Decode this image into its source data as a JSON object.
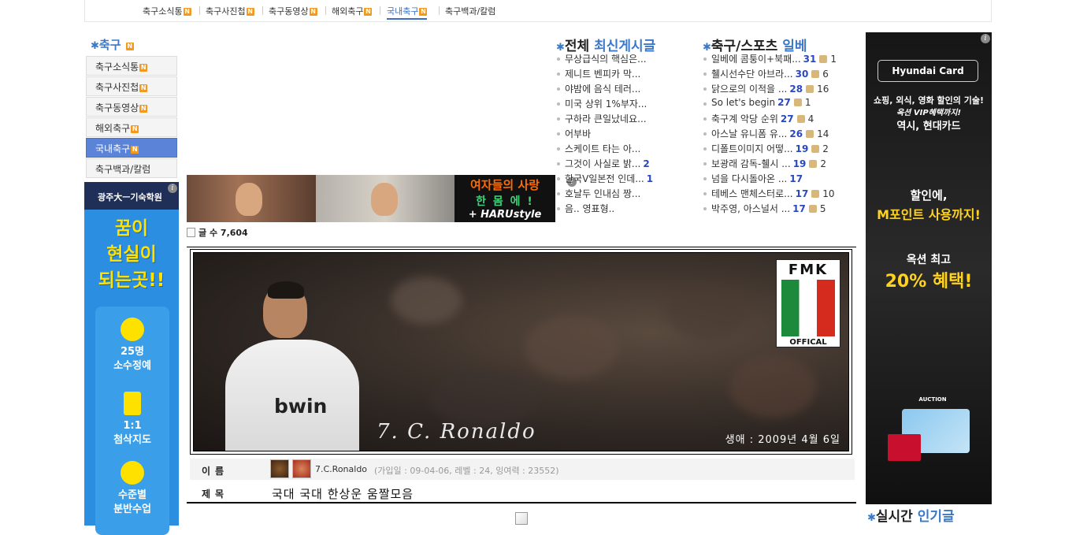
{
  "topnav": {
    "items": [
      {
        "label": "축구소식통",
        "badge": "N"
      },
      {
        "label": "축구사진첩",
        "badge": "N"
      },
      {
        "label": "축구동영상",
        "badge": "N"
      },
      {
        "label": "해외축구",
        "badge": "N"
      },
      {
        "label": "국내축구",
        "badge": "N",
        "active": true
      },
      {
        "label": "축구백과/칼럼",
        "badge": ""
      }
    ]
  },
  "sidebar": {
    "title": "축구",
    "title_badge": "N",
    "items": [
      {
        "label": "축구소식통",
        "badge": "N"
      },
      {
        "label": "축구사진첩",
        "badge": "N"
      },
      {
        "label": "축구동영상",
        "badge": "N"
      },
      {
        "label": "해외축구",
        "badge": "N"
      },
      {
        "label": "국내축구",
        "badge": "N",
        "selected": true
      },
      {
        "label": "축구백과/칼럼",
        "badge": ""
      }
    ]
  },
  "left_ad": {
    "header": "광주大ㅡ기숙학원",
    "headline": [
      "꿈이",
      "현실이",
      "되는곳!!"
    ],
    "features": [
      {
        "line1": "25명",
        "line2": "소수정예"
      },
      {
        "line1": "1:1",
        "line2": "첨삭지도"
      },
      {
        "line1": "수준별",
        "line2": "분반수업"
      }
    ]
  },
  "banner": {
    "text_line1": "여자들의 사랑",
    "text_line2": "한 몸 에 !",
    "text_line3": "+ HARUstyle"
  },
  "post_count": {
    "label": "글 수",
    "value": "7,604"
  },
  "latest_posts": {
    "heading_part1": "전체",
    "heading_part2": "최신게시글",
    "items": [
      {
        "title": "무상급식의 핵심은...",
        "count": ""
      },
      {
        "title": "제니트 벤피카 막...",
        "count": ""
      },
      {
        "title": "야밤에 음식 테러...",
        "count": ""
      },
      {
        "title": "미국 상위 1%부자...",
        "count": ""
      },
      {
        "title": "구하라 큰일났네요...",
        "count": ""
      },
      {
        "title": "어부바",
        "count": ""
      },
      {
        "title": "스케이트 타는 아...",
        "count": ""
      },
      {
        "title": "그것이 사실로 밝...",
        "count": "2"
      },
      {
        "title": "한국V일본전 인데...",
        "count": "1"
      },
      {
        "title": "호날두 인내심 짱...",
        "count": ""
      },
      {
        "title": "음.. 영표형..",
        "count": ""
      }
    ]
  },
  "best_posts": {
    "heading_part1": "축구/스포츠",
    "heading_part2": "일베",
    "items": [
      {
        "title": "일베에 콤퉁이+북패...",
        "count": "31",
        "likes": "1"
      },
      {
        "title": "췔시선수단 아브라...",
        "count": "30",
        "likes": "6"
      },
      {
        "title": "닭으로의 이적을 ...",
        "count": "28",
        "likes": "16"
      },
      {
        "title": "So let's begin",
        "count": "27",
        "likes": "1"
      },
      {
        "title": "축구계 악당 순위",
        "count": "27",
        "likes": "4"
      },
      {
        "title": "아스날 유니폼 유...",
        "count": "26",
        "likes": "14"
      },
      {
        "title": "디폴트이미지 어떻...",
        "count": "19",
        "likes": "2"
      },
      {
        "title": "보광래 감독-췔시 ...",
        "count": "19",
        "likes": "2"
      },
      {
        "title": "넘을 다시돌아온 ...",
        "count": "17",
        "likes": ""
      },
      {
        "title": "테베스 맨체스터로...",
        "count": "17",
        "likes": "10"
      },
      {
        "title": "박주영, 아스널서 ...",
        "count": "17",
        "likes": "5"
      }
    ]
  },
  "right_ad": {
    "logo": "Hyundai Card",
    "line1": "쇼핑, 외식, 영화 할인의 기술!",
    "line2": "옥션 VIP혜택까지!",
    "line3": "역시, 현대카드",
    "line4": "할인에,",
    "line5": "M포인트 사용까지!",
    "line6": "옥션 최고",
    "line7": "20% 혜택!",
    "auction": "AUCTION"
  },
  "realtime": {
    "part1": "실시간",
    "part2": "인기글"
  },
  "post": {
    "fmk_line1": "FMK",
    "fmk_line2": "OFFICAL",
    "jersey_text": "bwin",
    "signature": "7. C. Ronaldo",
    "date_caption": "생애 : 2009년 4월 6일",
    "name_label": "이름",
    "author": "7.C.Ronaldo",
    "author_meta": "(가입일 : 09-04-06, 레벨 : 24, 잉여력 : 23552)",
    "subject_label": "제목",
    "subject": "국대 국대 한상운 움짤모음"
  },
  "colors": {
    "accent": "#3b78c8",
    "badge": "#f39a1e",
    "count": "#2a48c0",
    "selected": "#5b84d8"
  }
}
